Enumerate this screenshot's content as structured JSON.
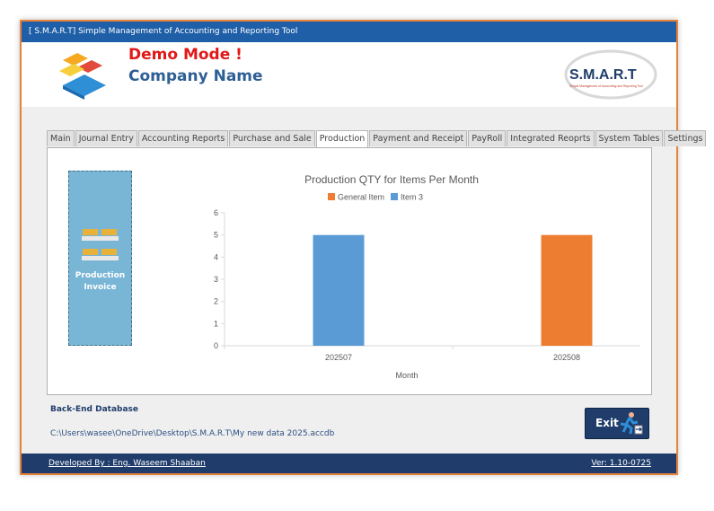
{
  "window": {
    "title": "[ S.M.A.R.T] Simple Management of Accounting and Reporting Tool"
  },
  "header": {
    "demo_text": "Demo Mode !",
    "company_name": "Company Name",
    "brand_text": "S.M.A.R.T",
    "brand_sub": "Simple Management of Accounting and Reporting Tool"
  },
  "tabs": [
    {
      "label": "Main"
    },
    {
      "label": "Journal Entry"
    },
    {
      "label": "Accounting Reports"
    },
    {
      "label": "Purchase and Sale"
    },
    {
      "label": "Production",
      "active": true
    },
    {
      "label": "Payment and Receipt"
    },
    {
      "label": "PayRoll"
    },
    {
      "label": "Integrated Reoprts"
    },
    {
      "label": "System Tables"
    },
    {
      "label": "Settings"
    }
  ],
  "production_button": {
    "line1": "Production",
    "line2": "Invoice"
  },
  "chart_data": {
    "type": "bar",
    "title": "Production QTY for Items Per Month",
    "xlabel": "Month",
    "ylabel": "",
    "categories": [
      "202507",
      "202508"
    ],
    "series": [
      {
        "name": "General Item",
        "color": "#ed7d31",
        "values": [
          0,
          5
        ]
      },
      {
        "name": "Item 3",
        "color": "#5b9bd5",
        "values": [
          5,
          0
        ]
      }
    ],
    "ylim": [
      0,
      6
    ],
    "yticks": [
      "0",
      "1",
      "2",
      "3",
      "4",
      "5",
      "6"
    ],
    "legend": "top-center",
    "grid": false
  },
  "backend": {
    "title": "Back-End Database",
    "path": "C:\\Users\\wasee\\OneDrive\\Desktop\\S.M.A.R.T\\My new data 2025.accdb"
  },
  "exit_button": {
    "label": "Exit",
    "icon": "running-exit-icon"
  },
  "status": {
    "developer": "Developed By : Eng. Waseem Shaaban",
    "version": "Ver: 1.10-0725"
  },
  "colors": {
    "accent": "#1f3c6b",
    "title_bar": "#1f5fa8",
    "demo_red": "#e01818",
    "border_orange": "#e8823a"
  }
}
